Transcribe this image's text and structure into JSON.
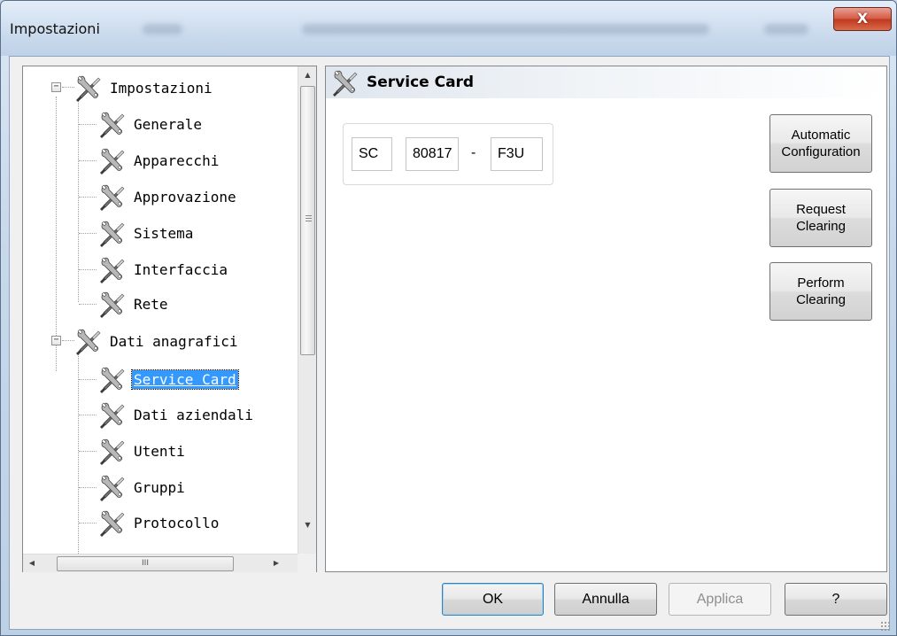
{
  "window": {
    "title": "Impostazioni",
    "close_label": "X"
  },
  "tree": {
    "items": [
      {
        "label": "Impostazioni",
        "level": 0,
        "expander": "−"
      },
      {
        "label": "Generale",
        "level": 1
      },
      {
        "label": "Apparecchi",
        "level": 1
      },
      {
        "label": "Approvazione",
        "level": 1
      },
      {
        "label": "Sistema",
        "level": 1
      },
      {
        "label": "Interfaccia",
        "level": 1
      },
      {
        "label": "Rete",
        "level": 1
      },
      {
        "label": "Dati anagrafici",
        "level": 0,
        "expander": "−"
      },
      {
        "label": "Service Card",
        "level": 1,
        "selected": true
      },
      {
        "label": "Dati aziendali",
        "level": 1
      },
      {
        "label": "Utenti",
        "level": 1
      },
      {
        "label": "Gruppi",
        "level": 1
      },
      {
        "label": "Protocollo",
        "level": 1
      }
    ],
    "hscroll_grip": "III"
  },
  "panel": {
    "title": "Service Card",
    "code_prefix": "SC",
    "code_number": "80817",
    "code_separator": "-",
    "code_suffix": "F3U",
    "buttons": {
      "automatic_configuration": "Automatic\nConfiguration",
      "request_clearing": "Request\nClearing",
      "perform_clearing": "Perform\nClearing"
    }
  },
  "dialog_buttons": {
    "ok": "OK",
    "cancel": "Annulla",
    "apply": "Applica",
    "help": "?"
  },
  "icons": {
    "tree_item": "tools-icon"
  },
  "colors": {
    "selection": "#3399ff",
    "close_button": "#c0391f"
  }
}
